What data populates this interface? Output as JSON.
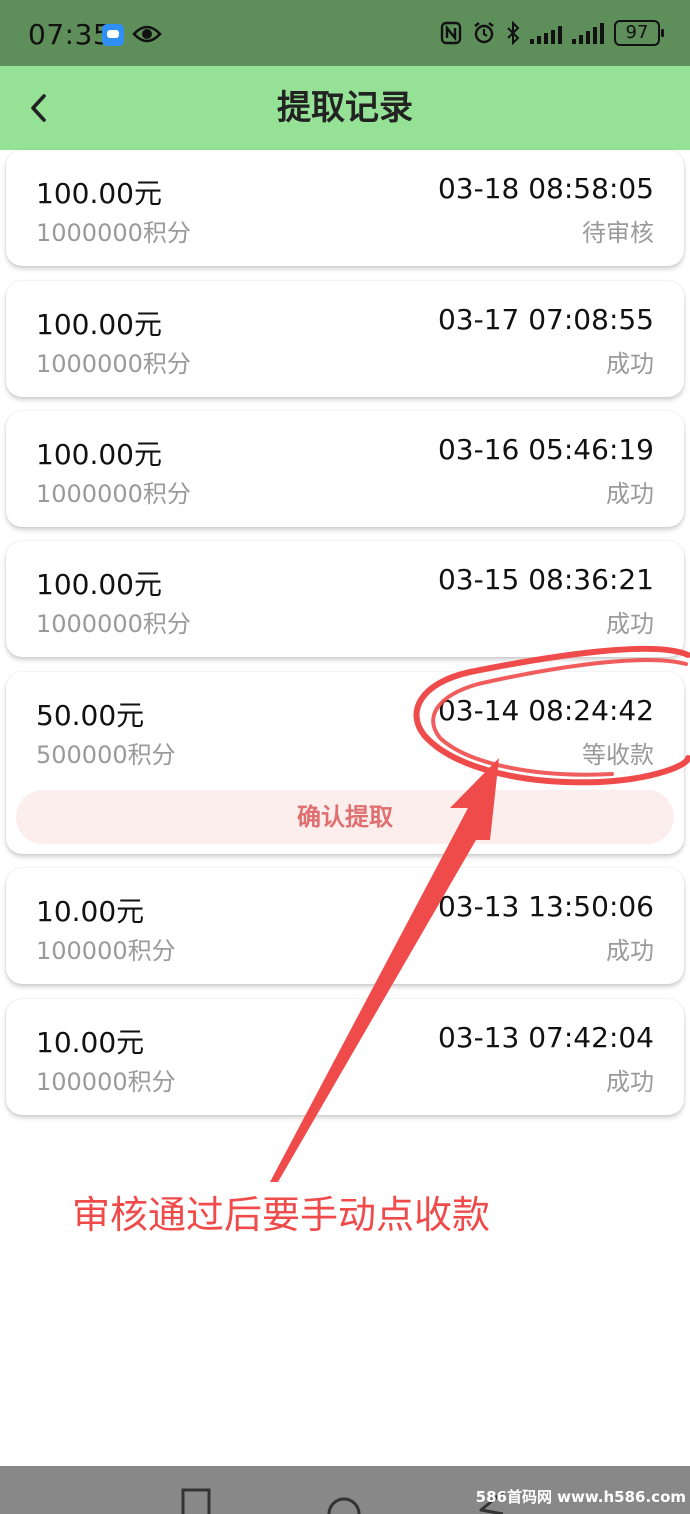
{
  "status_bar": {
    "time": "07:35",
    "battery": "97"
  },
  "header": {
    "title": "提取记录"
  },
  "records": [
    {
      "amount": "100.00元",
      "points": "1000000积分",
      "time": "03-18 08:58:05",
      "status": "待审核"
    },
    {
      "amount": "100.00元",
      "points": "1000000积分",
      "time": "03-17 07:08:55",
      "status": "成功"
    },
    {
      "amount": "100.00元",
      "points": "1000000积分",
      "time": "03-16 05:46:19",
      "status": "成功"
    },
    {
      "amount": "100.00元",
      "points": "1000000积分",
      "time": "03-15 08:36:21",
      "status": "成功"
    },
    {
      "amount": "50.00元",
      "points": "500000积分",
      "time": "03-14 08:24:42",
      "status": "等收款",
      "action_label": "确认提取"
    },
    {
      "amount": "10.00元",
      "points": "100000积分",
      "time": "03-13 13:50:06",
      "status": "成功"
    },
    {
      "amount": "10.00元",
      "points": "100000积分",
      "time": "03-13 07:42:04",
      "status": "成功"
    }
  ],
  "annotation": {
    "text": "审核通过后要手动点收款",
    "color": "#ef4b4b"
  },
  "watermark": "586首码网 www.h586.com",
  "colors": {
    "status_bar": "#5e8e5a",
    "header": "#95e196",
    "accent_button_bg": "#fdeeee",
    "accent_button_text": "#e07070"
  }
}
